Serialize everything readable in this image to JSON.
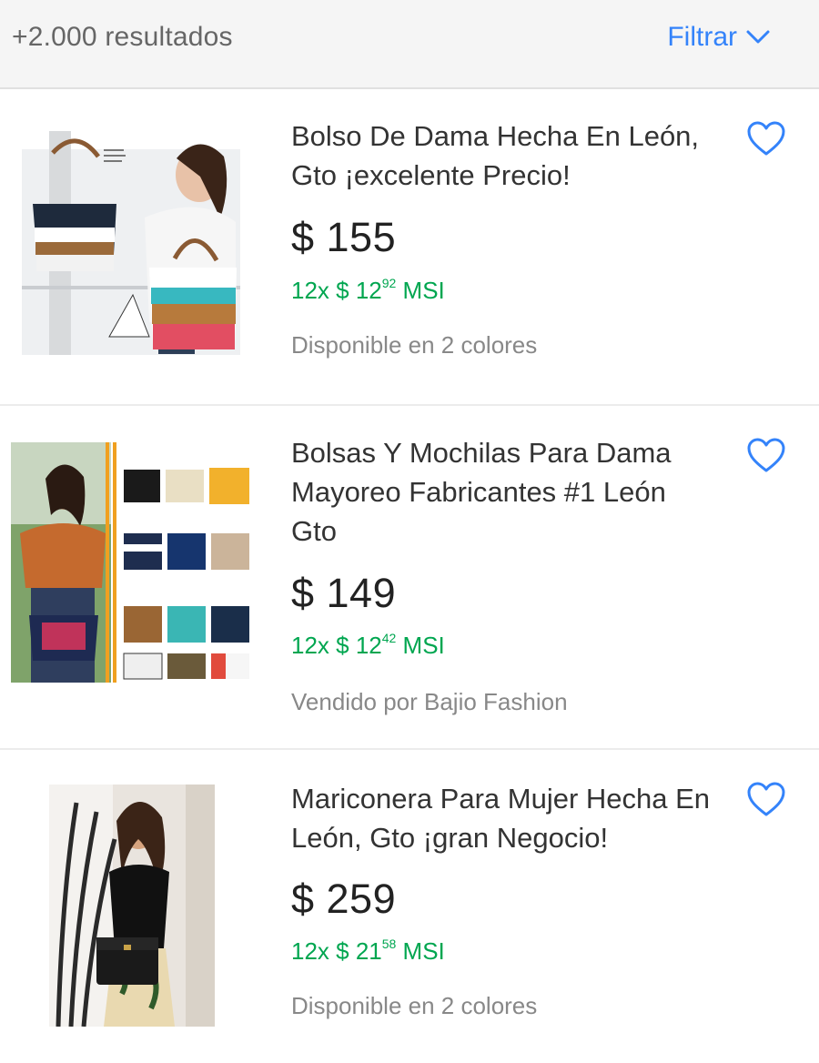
{
  "header": {
    "results_count": "+2.000 resultados",
    "filter_label": "Filtrar"
  },
  "colors": {
    "accent": "#3483fa",
    "installment_green": "#00a650",
    "muted_text": "#888888"
  },
  "items": [
    {
      "title": "Bolso De Dama  Hecha En León, Gto ¡excelente Precio!",
      "price": "$ 155",
      "installment_prefix": "12x $ 12",
      "installment_cents": "92",
      "installment_suffix": " MSI",
      "meta": "Disponible en 2 colores",
      "favorite_icon": "heart-outline-icon"
    },
    {
      "title": "Bolsas Y Mochilas Para Dama Mayoreo Fabricantes #1 León Gto",
      "price": "$ 149",
      "installment_prefix": "12x $ 12",
      "installment_cents": "42",
      "installment_suffix": " MSI",
      "meta": "Vendido por Bajio Fashion",
      "favorite_icon": "heart-outline-icon"
    },
    {
      "title": "Mariconera Para Mujer Hecha En León, Gto ¡gran Negocio!",
      "price": "$ 259",
      "installment_prefix": "12x $ 21",
      "installment_cents": "58",
      "installment_suffix": " MSI",
      "meta": "Disponible en 2 colores",
      "favorite_icon": "heart-outline-icon"
    }
  ]
}
